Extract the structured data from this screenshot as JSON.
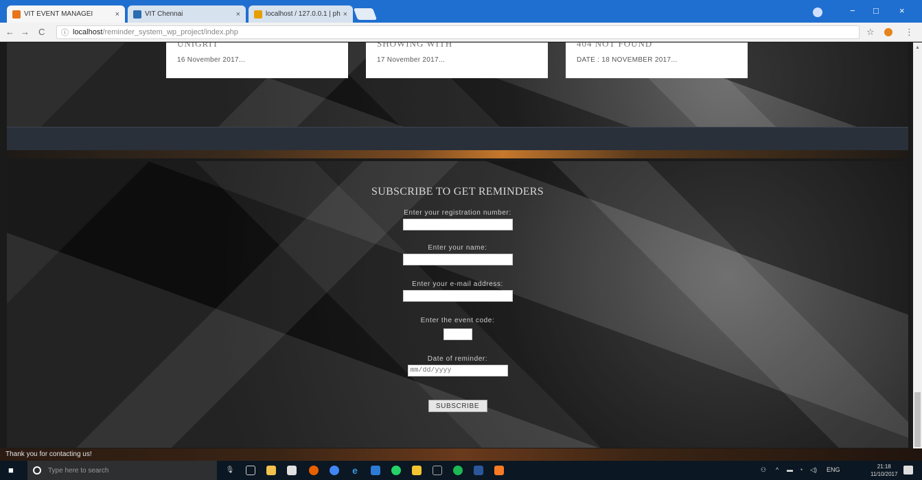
{
  "browser": {
    "tabs": [
      {
        "title": "VIT EVENT MANAGEI",
        "favicon_color": "#e8731b"
      },
      {
        "title": "VIT Chennai",
        "favicon_color": "#2b6cb0"
      },
      {
        "title": "localhost / 127.0.0.1 | ph",
        "favicon_color": "#e5a000"
      }
    ],
    "tab_close": "×",
    "url_host": "localhost",
    "url_path": "/reminder_system_wp_project/index.php",
    "info_icon": "ⓘ",
    "back": "←",
    "forward": "→",
    "reload": "C",
    "star": "☆",
    "menu": "⋮",
    "window_min": "−",
    "window_max": "□",
    "window_close": "×"
  },
  "events": [
    {
      "title": "UNIGRIT",
      "date": "16 November 2017..."
    },
    {
      "title": "SHOWING WITH",
      "date": "17 November 2017..."
    },
    {
      "title": "404 NOT FOUND",
      "date": "DATE : 18 NOVEMBER 2017..."
    }
  ],
  "subscribe": {
    "title": "SUBSCRIBE TO GET REMINDERS",
    "reg_label": "Enter your registration number:",
    "name_label": "Enter your name:",
    "email_label": "Enter your e-mail address:",
    "code_label": "Enter the event code:",
    "date_label": "Date of reminder:",
    "date_placeholder": "mm/dd/yyyy",
    "button": "SUBSCRIBE"
  },
  "footer": {
    "text": "Thank you for contacting us!"
  },
  "taskbar": {
    "start_icon": "■",
    "search_placeholder": "Type here to search",
    "lang": "ENG",
    "time": "21:18",
    "date": "11/10/2017"
  },
  "colors": {
    "tabstrip": "#1f6fd0",
    "taskbar": "#0b1722",
    "slate": "#29303a"
  }
}
